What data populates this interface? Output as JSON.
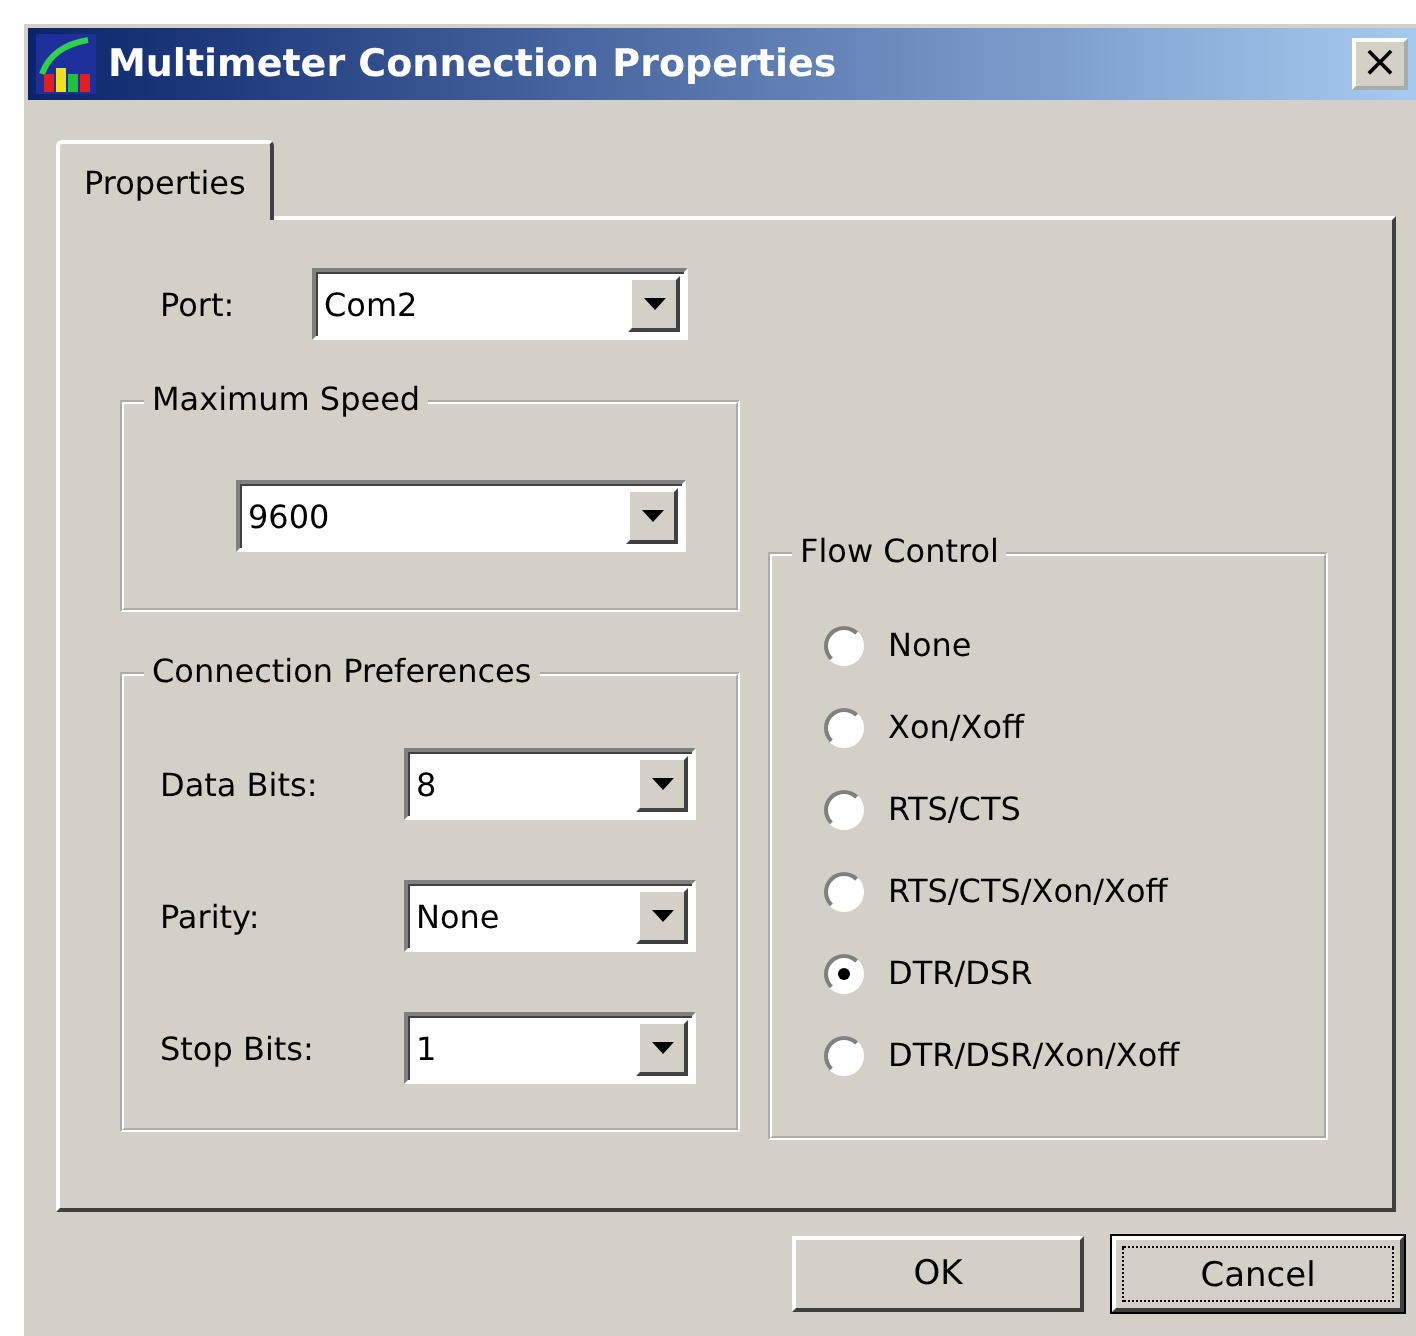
{
  "window": {
    "title": "Multimeter Connection Properties",
    "close": "×"
  },
  "tabs": [
    {
      "label": "Properties",
      "selected": true
    }
  ],
  "port": {
    "label": "Port:",
    "value": "Com2"
  },
  "maximum_speed": {
    "title": "Maximum Speed",
    "value": "9600"
  },
  "connection_preferences": {
    "title": "Connection Preferences",
    "fields": [
      {
        "label": "Data Bits:",
        "value": "8"
      },
      {
        "label": "Parity:",
        "value": "None"
      },
      {
        "label": "Stop Bits:",
        "value": "1"
      }
    ]
  },
  "flow_control": {
    "title": "Flow Control",
    "options": [
      {
        "label": "None",
        "selected": false
      },
      {
        "label": "Xon/Xoff",
        "selected": false
      },
      {
        "label": "RTS/CTS",
        "selected": false
      },
      {
        "label": "RTS/CTS/Xon/Xoff",
        "selected": false
      },
      {
        "label": "DTR/DSR",
        "selected": true
      },
      {
        "label": "DTR/DSR/Xon/Xoff",
        "selected": false
      }
    ]
  },
  "buttons": [
    {
      "label": "OK",
      "focused": false
    },
    {
      "label": "Cancel",
      "focused": true
    }
  ]
}
